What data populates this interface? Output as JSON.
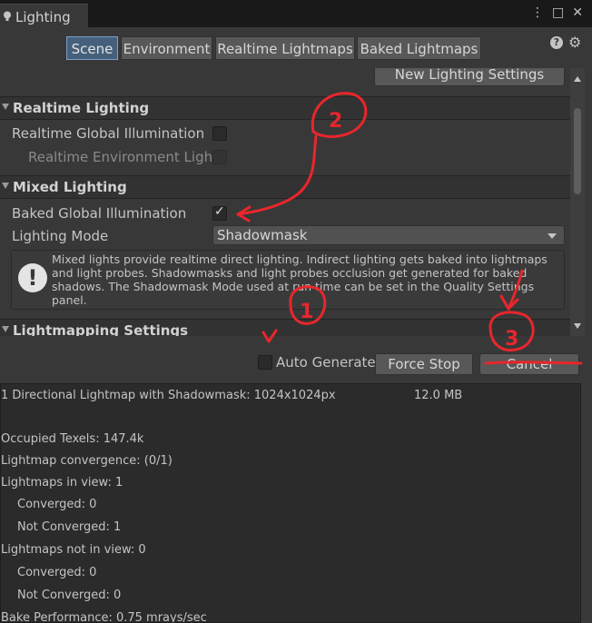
{
  "window": {
    "title": "Lighting",
    "controls": [
      "⋮",
      "□",
      "✕"
    ]
  },
  "tabs": [
    {
      "label": "Scene",
      "active": true
    },
    {
      "label": "Environment",
      "active": false
    },
    {
      "label": "Realtime Lightmaps",
      "active": false
    },
    {
      "label": "Baked Lightmaps",
      "active": false
    }
  ],
  "toolbar_icons": [
    "help-icon",
    "gear-icon"
  ],
  "scene": {
    "new_settings_button": "New Lighting Settings",
    "realtime_lighting": {
      "header": "Realtime Lighting",
      "realtime_gi_label": "Realtime Global Illumination",
      "realtime_gi_checked": false,
      "realtime_env_label": "Realtime Environment Light",
      "realtime_env_checked": false
    },
    "mixed_lighting": {
      "header": "Mixed Lighting",
      "baked_gi_label": "Baked Global Illumination",
      "baked_gi_checked": true,
      "lighting_mode_label": "Lighting Mode",
      "lighting_mode_value": "Shadowmask",
      "info_text": "Mixed lights provide realtime direct lighting. Indirect lighting gets baked into lightmaps and light probes. Shadowmasks and light probes occlusion get generated for baked shadows. The Shadowmask Mode used at run time can be set in the Quality Settings panel."
    },
    "lightmapping_settings": {
      "header": "Lightmapping Settings"
    }
  },
  "bake_bar": {
    "auto_generate_label": "Auto Generate",
    "auto_generate_checked": false,
    "force_stop_label": "Force Stop",
    "cancel_label": "Cancel"
  },
  "stats": {
    "summary": "1 Directional Lightmap with Shadowmask: 1024x1024px",
    "summary_size": "12.0 MB",
    "occupied_texels": "Occupied Texels: 147.4k",
    "convergence": "Lightmap convergence: (0/1)",
    "in_view": "Lightmaps in view: 1",
    "in_view_converged": "Converged: 0",
    "in_view_not_converged": "Not Converged: 1",
    "not_in_view": "Lightmaps not in view: 0",
    "not_in_view_converged": "Converged: 0",
    "not_in_view_not_converged": "Not Converged: 0",
    "bake_performance": "Bake Performance: 0.75 mrays/sec"
  },
  "annotations": {
    "color": "#e8262c",
    "labels": [
      "2",
      "1",
      "3"
    ]
  },
  "colors": {
    "active_tab": "#46607c",
    "panel_bg": "#383838",
    "stats_bg": "#2b2b2b"
  }
}
